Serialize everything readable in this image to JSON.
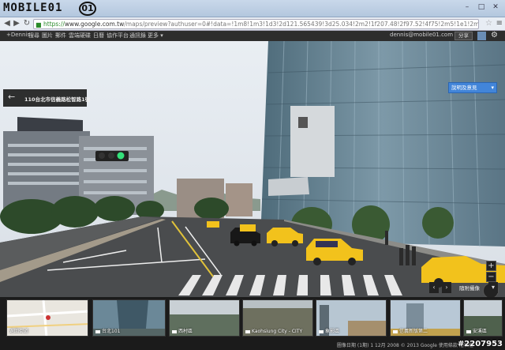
{
  "watermark_logo": {
    "text": "MOBILE01",
    "badge": "01"
  },
  "window_controls": {
    "minimize": "–",
    "maximize": "□",
    "close": "✕"
  },
  "address_bar": {
    "url_scheme": "https://",
    "url_host": "www.google.com.tw",
    "url_rest": "/maps/preview?authuser=0#!data=!1m8!1m3!1d3!2d121.565439!3d25.034!2m2!1f207.48!2f97.52!4f75!2m5!1e1!2m3!1sFkuG39Rhy1Zbicc18Ki"
  },
  "google_bar": {
    "items": [
      "+Dennis",
      "搜尋",
      "圖片",
      "郵件",
      "雲端硬碟",
      "日曆",
      "協作平台",
      "通訊錄",
      "更多 ▾"
    ],
    "email": "dennis@mobile01.com",
    "share_label": "分享"
  },
  "street_view": {
    "address": "110台北市信義路松智路1號",
    "feedback_label": "說明及意見",
    "feedback_arrow": "▾",
    "zoom_in": "+",
    "zoom_out": "−",
    "nearby_label": "隨附攝像"
  },
  "filmstrip": {
    "thumbs": [
      {
        "label": "返回街道",
        "camera": false
      },
      {
        "label": "台北101",
        "camera": true
      },
      {
        "label": "西村區",
        "camera": true
      },
      {
        "label": "Kaohsiung City - CITY",
        "camera": true
      },
      {
        "label": "象影區",
        "camera": true
      },
      {
        "label": "信義新版第二",
        "camera": true
      },
      {
        "label": "安溪區",
        "camera": true
      }
    ]
  },
  "footer": {
    "text": "圖像日期 (1期) 1 12月 2008   © 2013 Google   使用條款   隱私權",
    "watermark": "#2207953"
  },
  "colors": {
    "accent": "#4285d9",
    "bar": "#2d2d2d"
  }
}
